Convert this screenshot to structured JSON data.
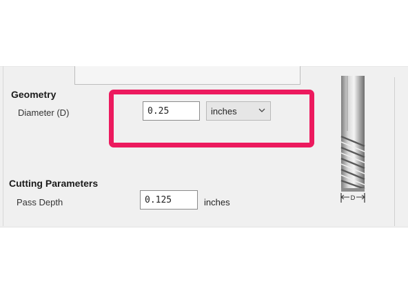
{
  "geometry": {
    "heading": "Geometry",
    "diameter_label": "Diameter (D)",
    "diameter_value": "0.25",
    "units_selected": "inches"
  },
  "cutting_parameters": {
    "heading": "Cutting Parameters",
    "pass_depth_label": "Pass Depth",
    "pass_depth_value": "0.125",
    "pass_depth_units": "inches"
  },
  "diagram": {
    "dimension_marker": "D"
  },
  "highlight": {
    "color": "#ec1a5e"
  },
  "icons": {
    "dropdown": "chevron-down-icon",
    "tool": "end-mill-tool-icon"
  }
}
